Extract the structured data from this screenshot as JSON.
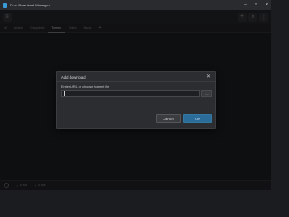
{
  "window": {
    "title": "Free Download Manager",
    "minimize_label": "–",
    "maximize_label": "□",
    "close_label": "✕"
  },
  "tabs": [
    {
      "label": "All"
    },
    {
      "label": "Active"
    },
    {
      "label": "Completed"
    },
    {
      "label": "Torrent"
    },
    {
      "label": "Video"
    },
    {
      "label": "Music"
    }
  ],
  "tab_add_label": "+",
  "status": {
    "download_speed": "0 B/s",
    "upload_speed": "0 B/s",
    "download_arrow": "↓",
    "upload_arrow": "↑"
  },
  "dialog": {
    "title": "Add download",
    "close_label": "✕",
    "prompt": "Enter URL or choose torrent file",
    "url_value": "",
    "browse_label": "...",
    "cancel_label": "Cancel",
    "ok_label": "OK"
  },
  "colors": {
    "accent": "#2c6c9a",
    "background": "#1b1c1f"
  },
  "icons": {
    "app": "app-icon",
    "menu": "menu-icon",
    "add": "add-icon",
    "search": "search-icon",
    "settings": "settings-icon"
  }
}
